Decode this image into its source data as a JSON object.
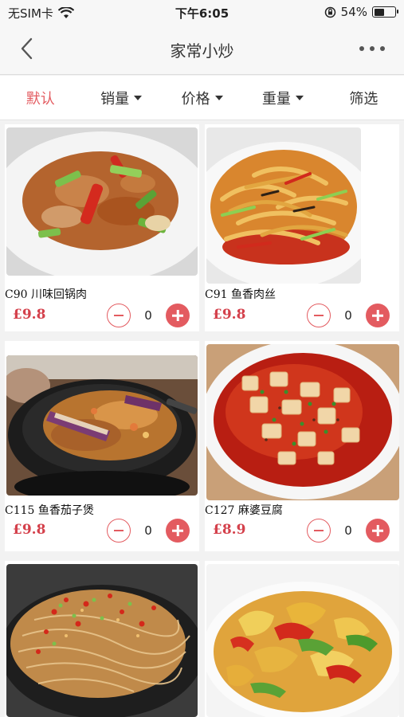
{
  "status": {
    "carrier": "无SIM卡",
    "time": "下午6:05",
    "battery": "54%",
    "battery_level": 0.54
  },
  "nav": {
    "title": "家常小炒"
  },
  "filters": [
    {
      "label": "默认"
    },
    {
      "label": "销量"
    },
    {
      "label": "价格"
    },
    {
      "label": "重量"
    },
    {
      "label": "筛选"
    }
  ],
  "items": [
    {
      "name": "C90 川味回锅肉",
      "price": "£9.8",
      "qty": "0"
    },
    {
      "name": "C91 鱼香肉丝",
      "price": "£9.8",
      "qty": "0"
    },
    {
      "name": "C115 鱼香茄子煲",
      "price": "£9.8",
      "qty": "0"
    },
    {
      "name": "C127 麻婆豆腐",
      "price": "£8.9",
      "qty": "0"
    }
  ],
  "colors": {
    "accent": "#e35b60",
    "price": "#d4404b"
  }
}
